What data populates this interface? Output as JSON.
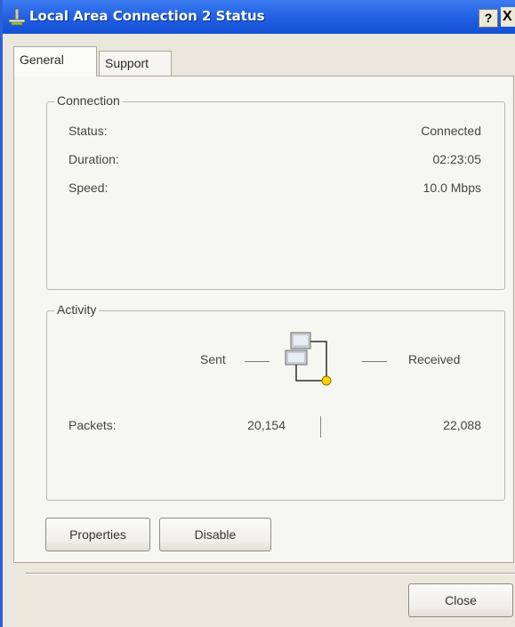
{
  "window": {
    "title": "Local Area Connection 2 Status",
    "help_label": "?",
    "close_label": "X"
  },
  "tabs": [
    {
      "label": "General",
      "selected": true
    },
    {
      "label": "Support",
      "selected": false
    }
  ],
  "connection": {
    "group_label": "Connection",
    "rows": [
      {
        "label": "Status:",
        "value": "Connected"
      },
      {
        "label": "Duration:",
        "value": "02:23:05"
      },
      {
        "label": "Speed:",
        "value": "10.0 Mbps"
      }
    ]
  },
  "activity": {
    "group_label": "Activity",
    "sent_label": "Sent",
    "received_label": "Received",
    "packets_label": "Packets:",
    "packets_sent": "20,154",
    "packets_received": "22,088"
  },
  "buttons": {
    "properties": "Properties",
    "disable": "Disable",
    "close": "Close"
  },
  "colors": {
    "titlebar": "#1f5ee2",
    "dialog_bg": "#eae8dd",
    "panel_bg": "#f7f7f2"
  }
}
